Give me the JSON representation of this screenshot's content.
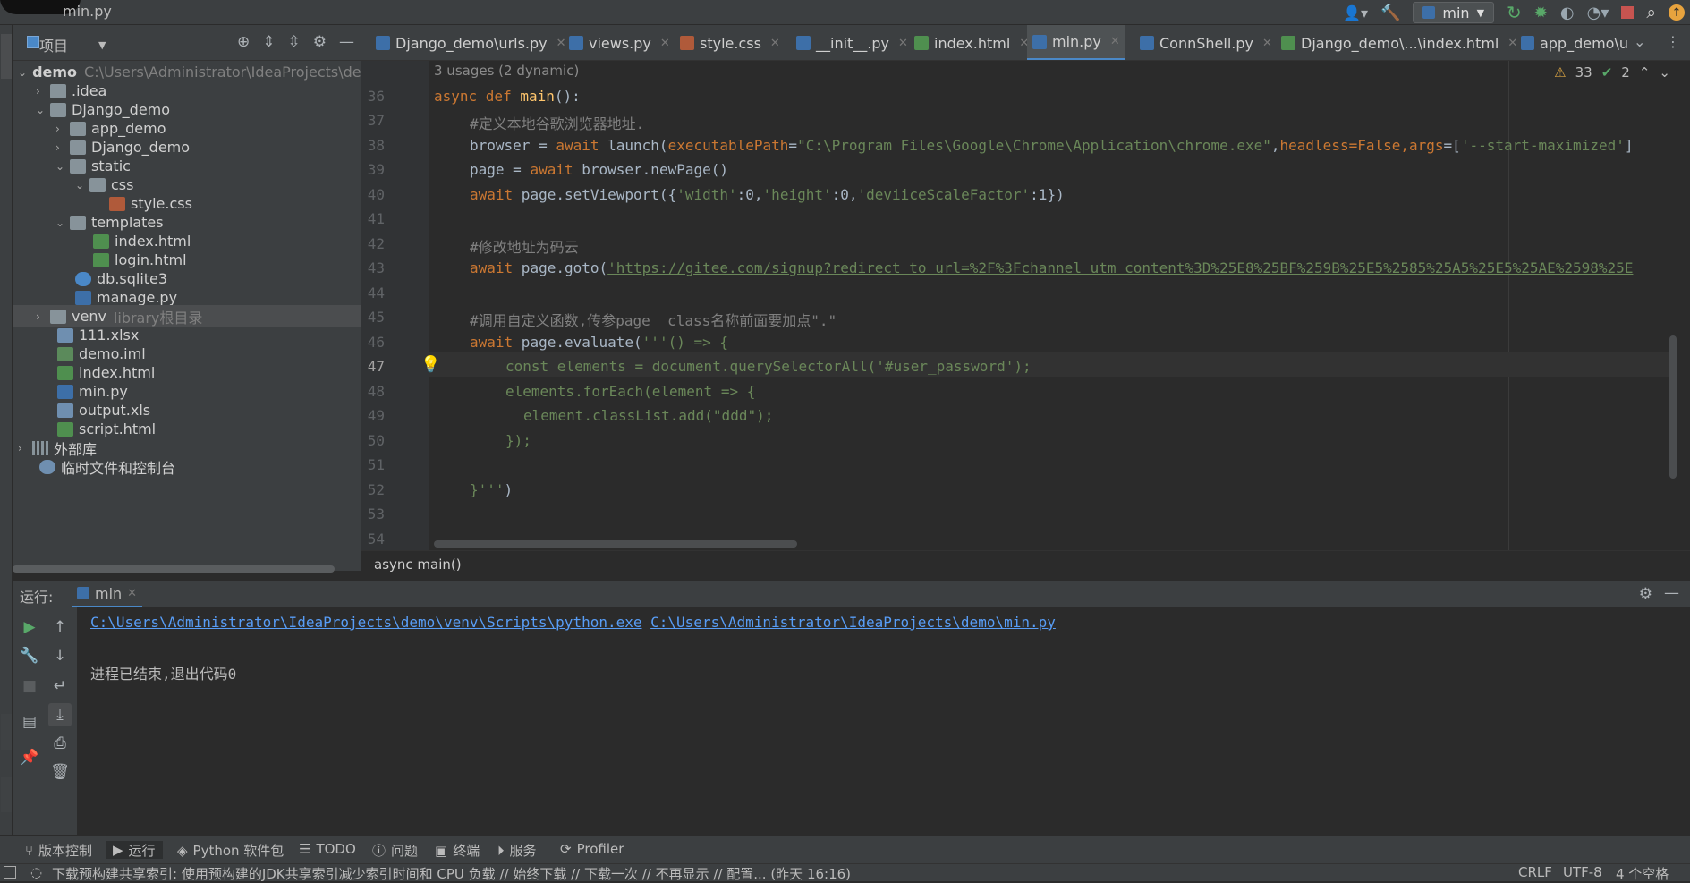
{
  "window": {
    "title": "min.py"
  },
  "toolbar": {
    "run_config": "min"
  },
  "project": {
    "label": "项目",
    "tree": [
      {
        "label": "demo",
        "path": "C:\\Users\\Administrator\\IdeaProjects\\demo",
        "icon": "folder-icon"
      },
      {
        "label": ".idea",
        "icon": "folder-icon"
      },
      {
        "label": "Django_demo",
        "icon": "folder-icon"
      },
      {
        "label": "app_demo",
        "icon": "folder-icon"
      },
      {
        "label": "Django_demo",
        "icon": "folder-icon"
      },
      {
        "label": "static",
        "icon": "folder-icon"
      },
      {
        "label": "css",
        "icon": "folder-icon"
      },
      {
        "label": "style.css",
        "icon": "css-file-icon"
      },
      {
        "label": "templates",
        "icon": "folder-icon"
      },
      {
        "label": "index.html",
        "icon": "html-file-icon"
      },
      {
        "label": "login.html",
        "icon": "html-file-icon"
      },
      {
        "label": "db.sqlite3",
        "icon": "database-icon"
      },
      {
        "label": "manage.py",
        "icon": "python-file-icon"
      },
      {
        "label": "venv",
        "extra": "library根目录",
        "icon": "folder-icon"
      },
      {
        "label": "111.xlsx",
        "icon": "excel-file-icon"
      },
      {
        "label": "demo.iml",
        "icon": "iml-file-icon"
      },
      {
        "label": "index.html",
        "icon": "html-file-icon"
      },
      {
        "label": "min.py",
        "icon": "python-file-icon"
      },
      {
        "label": "output.xls",
        "icon": "excel-file-icon"
      },
      {
        "label": "script.html",
        "icon": "html-file-icon"
      },
      {
        "label": "外部库",
        "icon": "library-icon"
      },
      {
        "label": "临时文件和控制台",
        "icon": "scratch-icon"
      }
    ]
  },
  "tabs": [
    {
      "label": "Django_demo\\urls.py",
      "icon": "python-file-icon"
    },
    {
      "label": "views.py",
      "icon": "python-file-icon"
    },
    {
      "label": "style.css",
      "icon": "css-file-icon"
    },
    {
      "label": "__init__.py",
      "icon": "python-file-icon"
    },
    {
      "label": "index.html",
      "icon": "html-file-icon"
    },
    {
      "label": "min.py",
      "icon": "python-file-icon",
      "active": true
    },
    {
      "label": "ConnShell.py",
      "icon": "python-file-icon"
    },
    {
      "label": "Django_demo\\...\\index.html",
      "icon": "html-file-icon"
    },
    {
      "label": "app_demo\\u",
      "icon": "python-file-icon"
    }
  ],
  "editor": {
    "usages": "3 usages (2 dynamic)",
    "warnings": "33",
    "weak_warnings": "2",
    "line_numbers": [
      "36",
      "37",
      "38",
      "39",
      "40",
      "41",
      "42",
      "43",
      "44",
      "45",
      "46",
      "47",
      "48",
      "49",
      "50",
      "51",
      "52",
      "53",
      "54"
    ],
    "code": {
      "l36_kw": "async def ",
      "l36_fn": "main",
      "l36_rest": "():",
      "l37": "#定义本地谷歌浏览器地址.",
      "l38_a": "browser = ",
      "l38_kw": "await",
      "l38_b": " launch(",
      "l38_p1": "executablePath",
      "l38_eq": "=",
      "l38_s1": "\"C:\\Program Files\\Google\\Chrome\\Application\\chrome.exe\"",
      "l38_c": ",",
      "l38_p2": "headless",
      "l38_f": "=False,",
      "l38_p3": "args",
      "l38_g": "=[",
      "l38_s2": "'--start-maximized'",
      "l38_h": "]",
      "l39_a": "page = ",
      "l39_kw": "await",
      "l39_b": " browser.newPage()",
      "l40_kw": "await",
      "l40_a": " page.setViewport({",
      "l40_s1": "'width'",
      "l40_b": ":0,",
      "l40_s2": "'height'",
      "l40_c": ":0,",
      "l40_s3": "'deviiceScaleFactor'",
      "l40_d": ":1})",
      "l42": "#修改地址为码云",
      "l43_kw": "await",
      "l43_a": " page.goto(",
      "l43_s": "'https://gitee.com/signup?redirect_to_url=%2F%3Fchannel_utm_content%3D%25E8%25BF%259B%25E5%2585%25A5%25E5%25AE%2598%25E",
      "l45": "#调用自定义函数,传参page  class名称前面要加点\".\"",
      "l46_kw": "await",
      "l46_a": " page.evaluate(",
      "l46_s": "'''() => {",
      "l47": "const elements = document.querySelectorAll('#user_password');",
      "l48": "elements.forEach(element => {",
      "l49": "element.classList.add(\"ddd\");",
      "l50": "});",
      "l52_s": "}'''",
      "l52_b": ")"
    },
    "breadcrumb": "async main()"
  },
  "run": {
    "label": "运行:",
    "tab": "min",
    "python_exe": "C:\\Users\\Administrator\\IdeaProjects\\demo\\venv\\Scripts\\python.exe",
    "script_path": "C:\\Users\\Administrator\\IdeaProjects\\demo\\min.py",
    "exit_message": "进程已结束,退出代码0"
  },
  "tool_windows": [
    {
      "label": "版本控制",
      "icon": "branch-icon"
    },
    {
      "label": "运行",
      "icon": "play-icon",
      "active": true
    },
    {
      "label": "Python 软件包",
      "icon": "package-icon"
    },
    {
      "label": "TODO",
      "icon": "list-icon"
    },
    {
      "label": "问题",
      "icon": "info-icon"
    },
    {
      "label": "终端",
      "icon": "terminal-icon"
    },
    {
      "label": "服务",
      "icon": "play-circle-icon"
    },
    {
      "label": "Profiler",
      "icon": "profiler-icon"
    }
  ],
  "status": {
    "message": "下载预构建共享索引: 使用预构建的JDK共享索引减少索引时间和 CPU 负载 // 始终下载 // 下载一次 // 不再显示 // 配置... (昨天 16:16)",
    "line_sep": "CRLF",
    "encoding": "UTF-8",
    "indent": "4 个空格"
  },
  "colors": {
    "accent": "#4a88c7",
    "keyword": "#cc7832",
    "string": "#6a8759",
    "comment": "#808080",
    "function": "#ffc66d"
  }
}
